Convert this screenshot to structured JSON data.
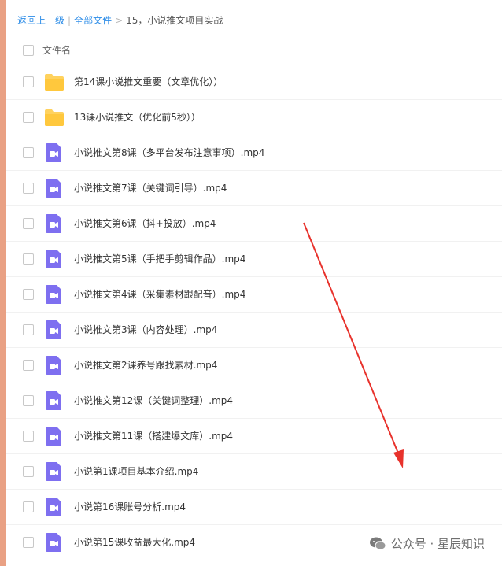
{
  "breadcrumb": {
    "back_label": "返回上一级",
    "separator": "|",
    "root_label": "全部文件",
    "chevron": ">",
    "current_label": "15，小说推文项目实战"
  },
  "list": {
    "header_label": "文件名",
    "files": [
      {
        "type": "folder",
        "name": "第14课小说推文重要（文章优化））"
      },
      {
        "type": "folder",
        "name": "13课小说推文（优化前5秒））"
      },
      {
        "type": "video",
        "name": "小说推文第8课（多平台发布注意事项）.mp4"
      },
      {
        "type": "video",
        "name": "小说推文第7课（关键词引导）.mp4"
      },
      {
        "type": "video",
        "name": "小说推文第6课（抖+投放）.mp4"
      },
      {
        "type": "video",
        "name": "小说推文第5课（手把手剪辑作品）.mp4"
      },
      {
        "type": "video",
        "name": "小说推文第4课（采集素材跟配音）.mp4"
      },
      {
        "type": "video",
        "name": "小说推文第3课（内容处理）.mp4"
      },
      {
        "type": "video",
        "name": "小说推文第2课养号跟找素材.mp4"
      },
      {
        "type": "video",
        "name": "小说推文第12课（关键词整理）.mp4"
      },
      {
        "type": "video",
        "name": "小说推文第11课（搭建爆文库）.mp4"
      },
      {
        "type": "video",
        "name": "小说第1课项目基本介绍.mp4"
      },
      {
        "type": "video",
        "name": "小说第16课账号分析.mp4"
      },
      {
        "type": "video",
        "name": "小说第15课收益最大化.mp4"
      }
    ]
  },
  "watermark": {
    "text": "公众号 · 星辰知识"
  },
  "colors": {
    "link": "#2f8ee8",
    "folder": "#ffd25e",
    "video": "#7e6ff0",
    "arrow": "#e8322c",
    "edge": "#e9a184"
  }
}
